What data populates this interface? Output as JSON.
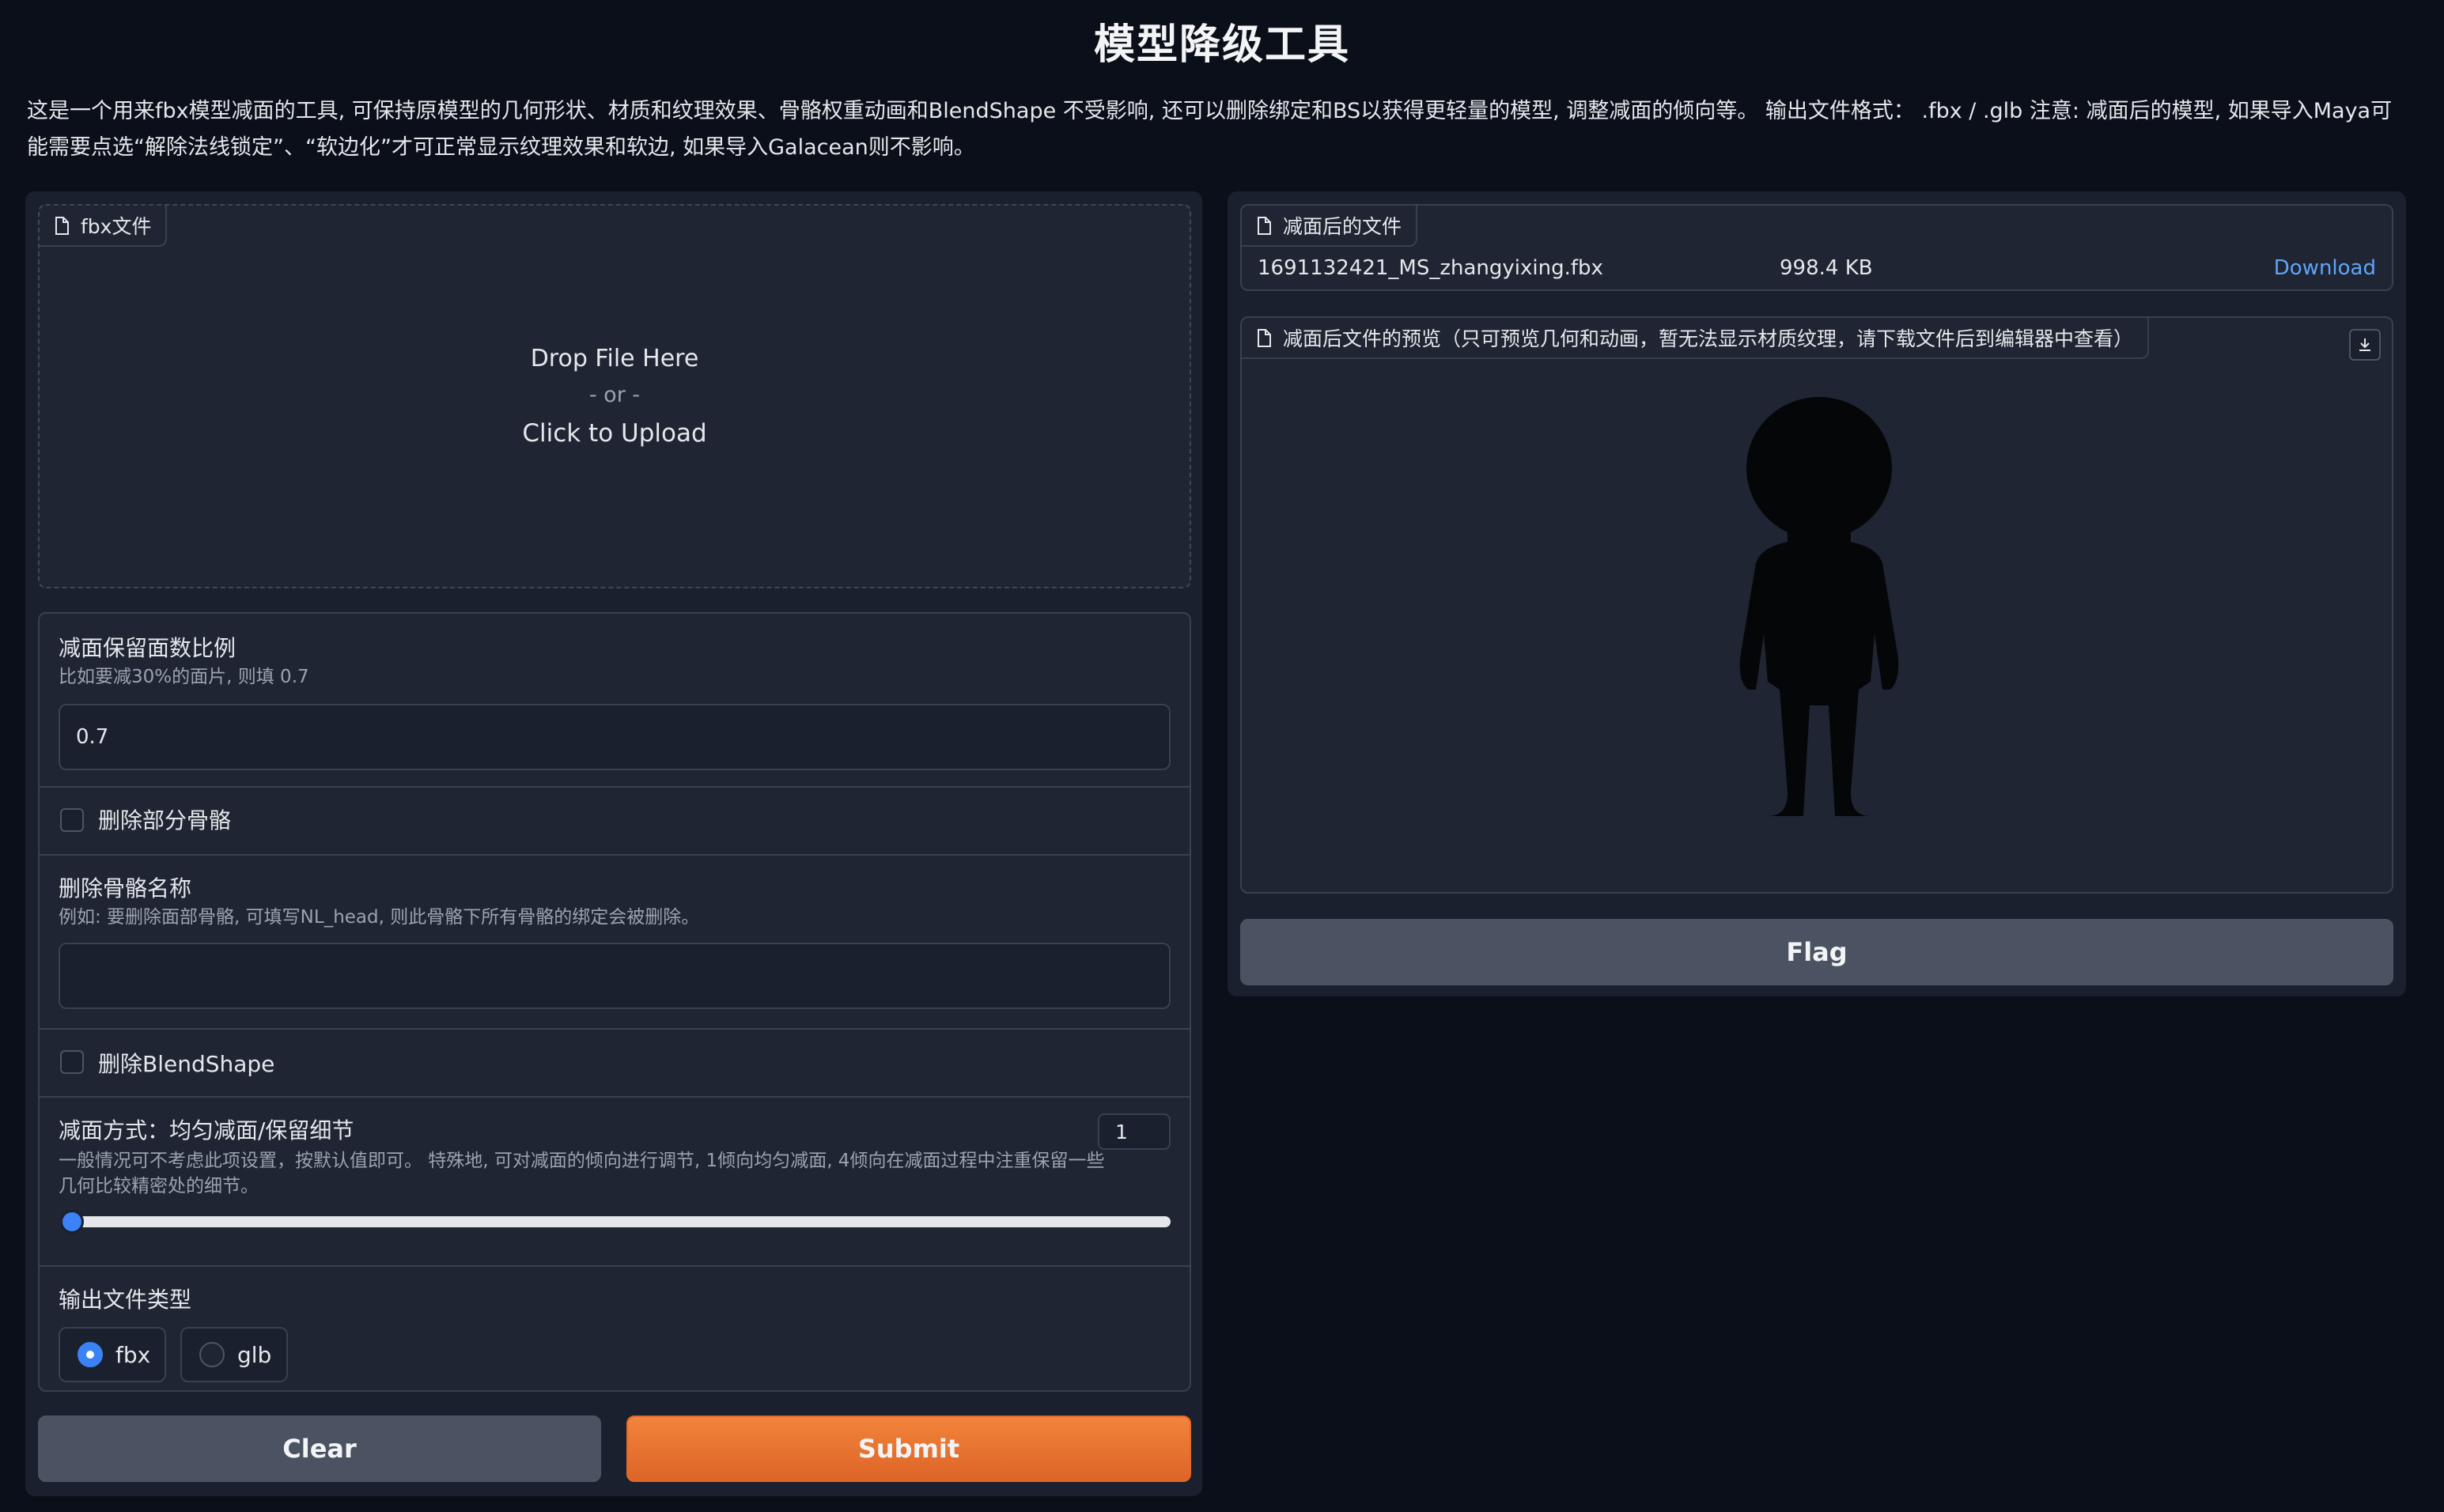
{
  "page": {
    "title": "模型降级工具",
    "description": "这是一个用来fbx模型减面的工具, 可保持原模型的几何形状、材质和纹理效果、骨骼权重动画和BlendShape 不受影响, 还可以删除绑定和BS以获得更轻量的模型, 调整减面的倾向等。 输出文件格式： .fbx / .glb 注意: 减面后的模型, 如果导入Maya可能需要点选“解除法线锁定”、“软边化”才可正常显示纹理效果和软边, 如果导入Galacean则不影响。"
  },
  "input_file": {
    "label": "fbx文件",
    "drop_text": "Drop File Here",
    "or_text": "- or -",
    "click_text": "Click to Upload"
  },
  "ratio": {
    "label": "减面保留面数比例",
    "info": "比如要减30%的面片, 则填 0.7",
    "value": "0.7"
  },
  "delete_bones": {
    "label": "删除部分骨骼",
    "checked": false
  },
  "bone_name": {
    "label": "删除骨骼名称",
    "info": "例如: 要删除面部骨骼, 可填写NL_head, 则此骨骼下所有骨骼的绑定会被删除。",
    "value": ""
  },
  "delete_blendshape": {
    "label": "删除BlendShape",
    "checked": false
  },
  "mode": {
    "label": "减面方式：均匀减面/保留细节",
    "info": "一般情况可不考虑此项设置，按默认值即可。 特殊地, 可对减面的倾向进行调节, 1倾向均匀减面, 4倾向在减面过程中注重保留一些几何比较精密处的细节。",
    "value": "1",
    "min": 1,
    "max": 4
  },
  "output_type": {
    "label": "输出文件类型",
    "options": [
      "fbx",
      "glb"
    ],
    "selected": "fbx"
  },
  "buttons": {
    "clear": "Clear",
    "submit": "Submit",
    "flag": "Flag"
  },
  "output_file": {
    "label": "减面后的文件",
    "file_name": "1691132421_MS_zhangyixing.fbx",
    "file_size": "998.4 KB",
    "download": "Download"
  },
  "preview": {
    "label": "减面后文件的预览（只可预览几何和动画，暂无法显示材质纹理，请下载文件后到编辑器中查看）"
  },
  "colors": {
    "background": "#0b0f19",
    "panel": "#1a202d",
    "accent": "#3b82f6",
    "submit": "#e86f30",
    "link": "#60a5fa"
  }
}
